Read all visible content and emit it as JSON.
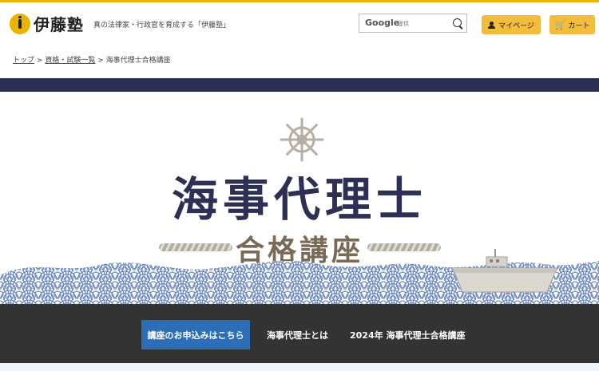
{
  "header": {
    "logo_text": "伊藤塾",
    "tagline": "真の法律家・行政官を育成する「伊藤塾」",
    "search": {
      "brand": "Google",
      "provided": "提供",
      "icon": "search-icon"
    },
    "mypage_label": "マイページ",
    "cart_label": "カート",
    "cart_icon": "🛒"
  },
  "breadcrumb": {
    "items": [
      "トップ",
      "資格・試験一覧",
      "海事代理士合格講座"
    ],
    "separator": ">"
  },
  "hero": {
    "title": "海事代理士",
    "subtitle": "合格講座",
    "colors": {
      "navy": "#2d2f55",
      "brown": "#7a6a55",
      "wave_blue": "#6b86c0"
    }
  },
  "nav": {
    "apply_label": "講座のお申込みはこちら",
    "links": [
      "海事代理士とは",
      "2024年 海事代理士合格講座"
    ]
  },
  "colors": {
    "accent": "#f2bd3d",
    "button_blue": "#2c6fb6",
    "nav_bg": "#333333"
  }
}
